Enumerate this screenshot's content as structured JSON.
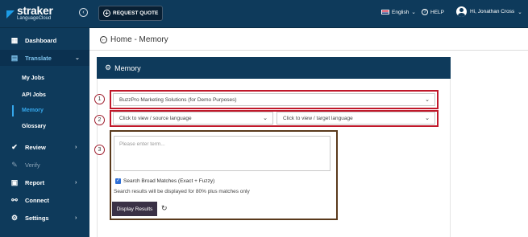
{
  "brand": {
    "name": "straker",
    "sub": "LanguageCloud"
  },
  "topbar": {
    "collapse_icon": "chevron-left-circle-icon",
    "request_quote": "REQUEST QUOTE",
    "language": "English",
    "help": "HELP",
    "user": "Hi, Jonathan Cross"
  },
  "sidebar": {
    "items": [
      {
        "label": "Dashboard",
        "icon": "grid-icon"
      },
      {
        "label": "Translate",
        "icon": "translate-icon"
      },
      {
        "label": "Review",
        "icon": "check-circle-icon"
      },
      {
        "label": "Verify",
        "icon": "edit-icon"
      },
      {
        "label": "Report",
        "icon": "report-icon"
      },
      {
        "label": "Connect",
        "icon": "connect-icon"
      },
      {
        "label": "Settings",
        "icon": "gear-icon"
      }
    ],
    "sub_items": [
      "My Jobs",
      "API Jobs",
      "Memory",
      "Glossary"
    ],
    "current_sub": "Memory",
    "active_color": "#35a7ec"
  },
  "page": {
    "title": "Home - Memory"
  },
  "panel": {
    "title": "Memory",
    "company_select": "BuzzPro Marketing Solutions (for Demo Purposes)",
    "source_select": "Click to view / source language",
    "target_select": "Click to view / target language",
    "term_placeholder": "Please enter term...",
    "broad_matches": "Search Broad Matches (Exact + Fuzzy)",
    "broad_matches_checked": true,
    "note": "Search results will be displayed for 80% plus matches only",
    "display_button": "Display Results"
  },
  "callouts": [
    "1",
    "2",
    "3"
  ],
  "colors": {
    "nav": "#0e3a5b",
    "highlight_red": "#c0182a",
    "highlight_brown": "#5a3a1c",
    "button": "#3a3146"
  }
}
